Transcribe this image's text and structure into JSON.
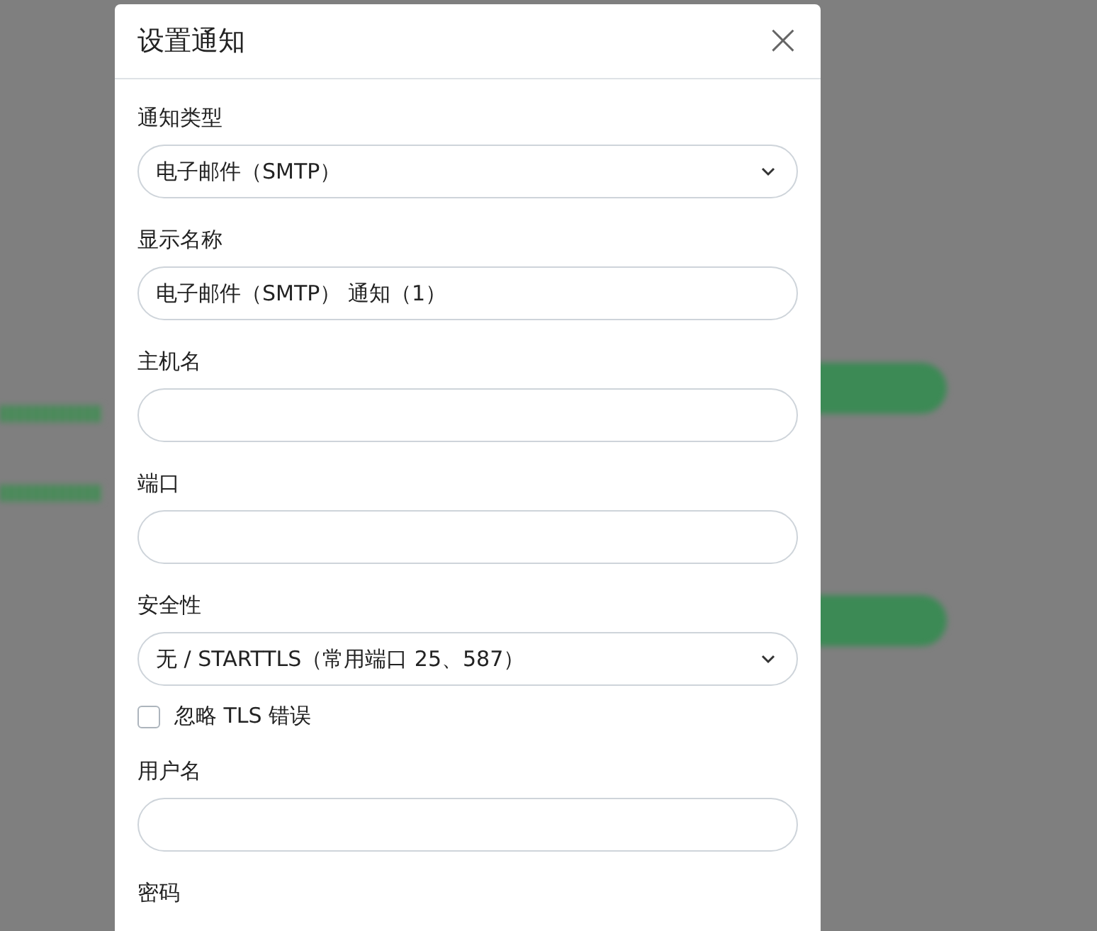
{
  "dialog": {
    "title": "设置通知",
    "close": "×"
  },
  "fields": [
    {
      "kind": "select",
      "label": "通知类型",
      "value": "电子邮件（SMTP）"
    },
    {
      "kind": "text",
      "label": "显示名称",
      "value": "电子邮件（SMTP） 通知（1）"
    },
    {
      "kind": "text",
      "label": "主机名"
    },
    {
      "kind": "text",
      "label": "端口"
    },
    {
      "kind": "select",
      "label": "安全性",
      "value": "无 / STARTTLS（常用端口 25、587）"
    },
    {
      "kind": "checkbox",
      "label": "忽略 TLS 错误",
      "checked": false
    },
    {
      "kind": "text",
      "label": "用户名"
    },
    {
      "kind": "label",
      "label": "密码"
    }
  ]
}
